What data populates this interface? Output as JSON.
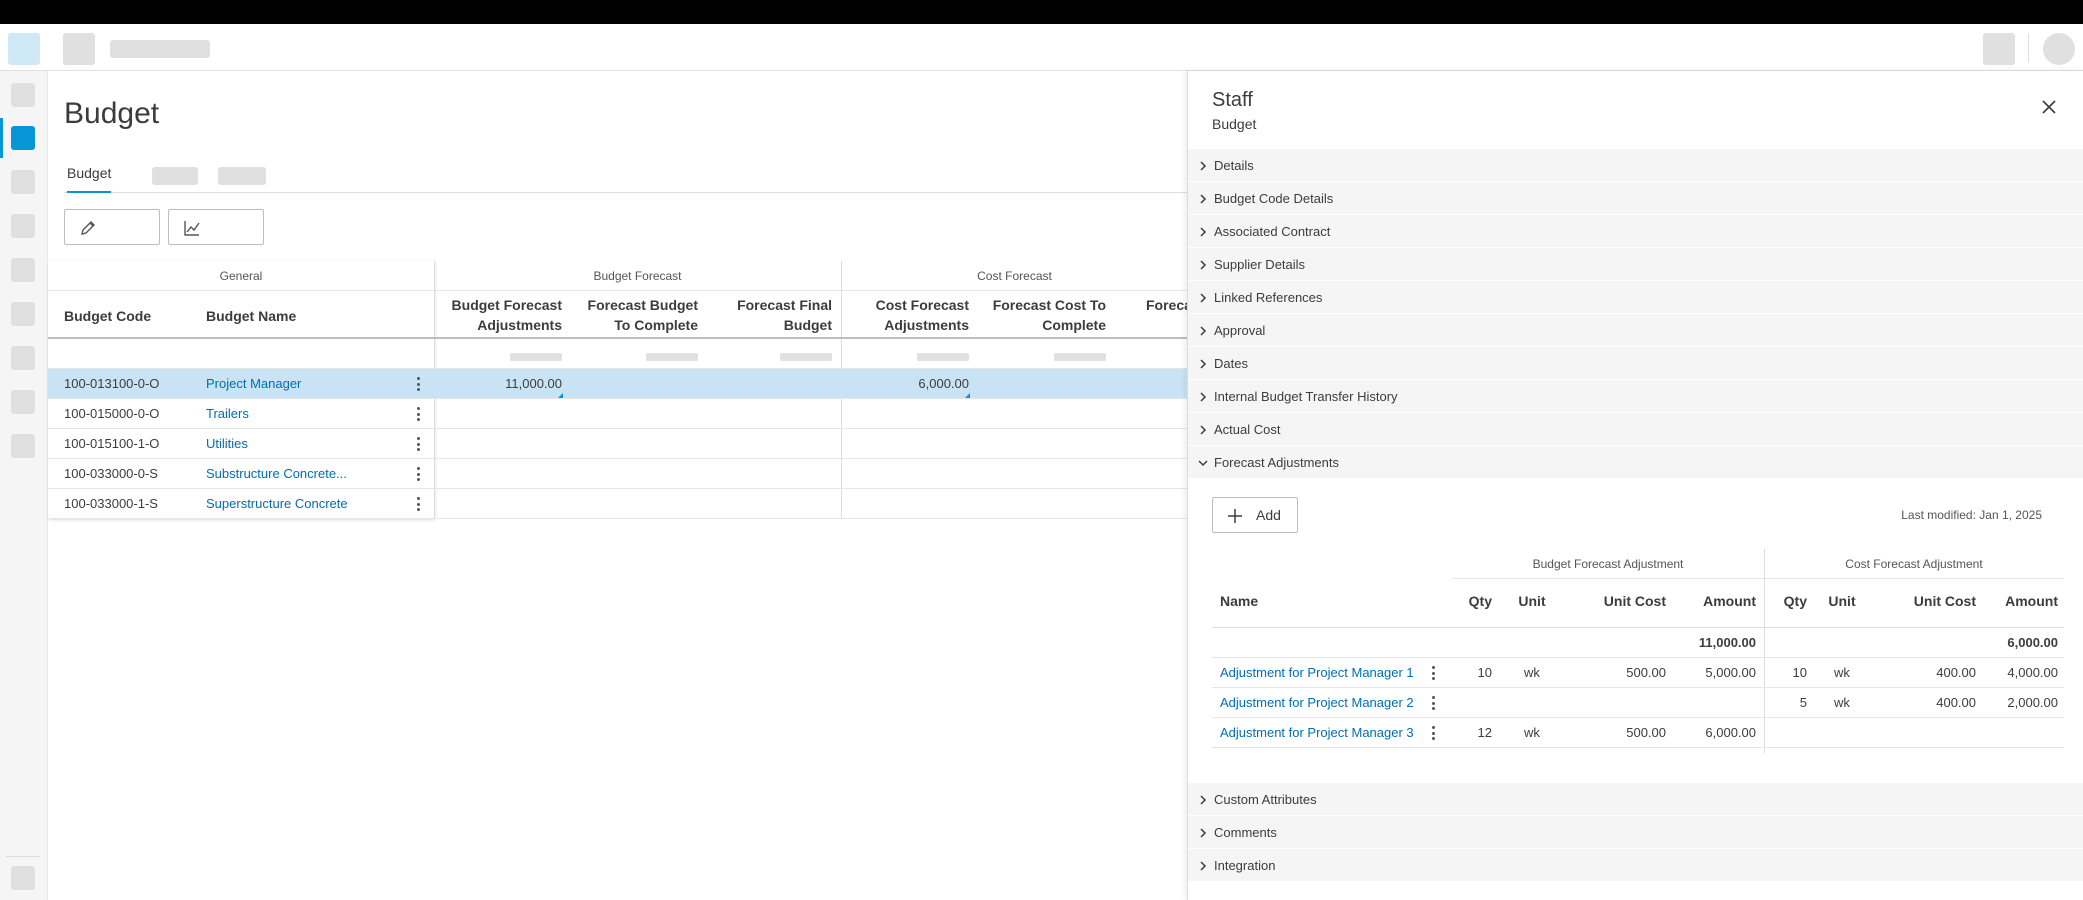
{
  "page": {
    "title": "Budget",
    "tabs": [
      {
        "label": "Budget"
      }
    ]
  },
  "grid": {
    "groups": {
      "general": "General",
      "budget_forecast": "Budget Forecast",
      "cost_forecast": "Cost Forecast"
    },
    "columns": {
      "budget_code": "Budget Code",
      "budget_name": "Budget Name",
      "bf_adj_1": "Budget Forecast",
      "bf_adj_2": "Adjustments",
      "bf_btc_1": "Forecast Budget",
      "bf_btc_2": "To Complete",
      "bf_final_1": "Forecast Final",
      "bf_final_2": "Budget",
      "cf_adj_1": "Cost Forecast",
      "cf_adj_2": "Adjustments",
      "cf_ctc_1": "Forecast Cost To",
      "cf_ctc_2": "Complete",
      "cf_trunc": "Foreca"
    },
    "rows": [
      {
        "code": "100-013100-0-O",
        "name": "Project Manager",
        "bf_adj": "11,000.00",
        "cf_adj": "6,000.00",
        "selected": true
      },
      {
        "code": "100-015000-0-O",
        "name": "Trailers",
        "bf_adj": "",
        "cf_adj": "",
        "selected": false
      },
      {
        "code": "100-015100-1-O",
        "name": "Utilities",
        "bf_adj": "",
        "cf_adj": "",
        "selected": false
      },
      {
        "code": "100-033000-0-S",
        "name": "Substructure Concrete...",
        "bf_adj": "",
        "cf_adj": "",
        "selected": false
      },
      {
        "code": "100-033000-1-S",
        "name": "Superstructure Concrete",
        "bf_adj": "",
        "cf_adj": "",
        "selected": false
      }
    ]
  },
  "panel": {
    "title": "Staff",
    "subtitle": "Budget",
    "sections_top": [
      "Details",
      "Budget Code Details",
      "Associated Contract",
      "Supplier Details",
      "Linked References",
      "Approval",
      "Dates",
      "Internal Budget Transfer History",
      "Actual Cost"
    ],
    "expanded_section": "Forecast Adjustments",
    "sections_bottom": [
      "Custom Attributes",
      "Comments",
      "Integration"
    ],
    "forecast": {
      "add_label": "Add",
      "last_modified": "Last modified: Jan 1, 2025",
      "groups": {
        "budget": "Budget Forecast Adjustment",
        "cost": "Cost Forecast Adjustment"
      },
      "headers": {
        "name": "Name",
        "qty": "Qty",
        "unit": "Unit",
        "unit_cost": "Unit Cost",
        "amount": "Amount"
      },
      "totals": {
        "budget_amount": "11,000.00",
        "cost_amount": "6,000.00"
      },
      "rows": [
        {
          "name": "Adjustment for Project Manager 1",
          "b_qty": "10",
          "b_unit": "wk",
          "b_unit_cost": "500.00",
          "b_amount": "5,000.00",
          "c_qty": "10",
          "c_unit": "wk",
          "c_unit_cost": "400.00",
          "c_amount": "4,000.00"
        },
        {
          "name": "Adjustment for Project Manager 2",
          "b_qty": "",
          "b_unit": "",
          "b_unit_cost": "",
          "b_amount": "",
          "c_qty": "5",
          "c_unit": "wk",
          "c_unit_cost": "400.00",
          "c_amount": "2,000.00"
        },
        {
          "name": "Adjustment for Project Manager 3",
          "b_qty": "12",
          "b_unit": "wk",
          "b_unit_cost": "500.00",
          "b_amount": "6,000.00",
          "c_qty": "",
          "c_unit": "",
          "c_unit_cost": "",
          "c_amount": ""
        }
      ]
    }
  },
  "colors": {
    "accent": "#0696d7",
    "link": "#006eaf",
    "selected_row": "#c8e4f4"
  },
  "icons": [
    "pencil-icon",
    "chart-icon",
    "close-icon",
    "chevron-right-icon",
    "chevron-down-icon",
    "plus-icon",
    "kebab-menu-icon"
  ]
}
